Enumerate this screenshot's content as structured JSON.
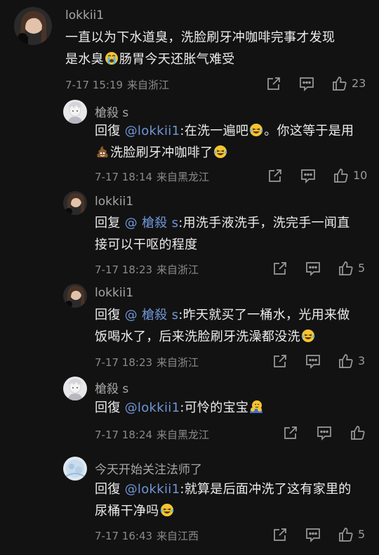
{
  "comments": [
    {
      "user": "lokkii1",
      "text_a": "一直以为下水道臭，洗脸刷牙冲咖啡完事才发现",
      "text_b1": "是水臭",
      "text_b2": "肠胃今天还胀气难受",
      "emoji_1": "crying-face",
      "time": "7-17 15:19",
      "location": "来自浙江",
      "likes": "23"
    },
    {
      "user": "槍殺 s",
      "reply_prefix": "回復 ",
      "mention": "@lokkii1",
      "line1_rest": ":在洗一遍吧",
      "line1_tail": "。你这等于是用",
      "line2_text": "洗脸刷牙冲咖啡了",
      "emoji_1": "laughing-crying-face",
      "emoji_2": "poop",
      "emoji_3": "laughing-crying-face",
      "time": "7-17 18:14",
      "location": "来自黑龙江",
      "likes": "10"
    },
    {
      "user": "lokkii1",
      "reply_prefix": "回复 ",
      "mention": "@ 槍殺 s",
      "line1_rest": ":用洗手液洗手，洗完手一闻直",
      "line2_text": "接可以干呕的程度",
      "time": "7-17 18:23",
      "location": "来自浙江",
      "likes": "5"
    },
    {
      "user": "lokkii1",
      "reply_prefix": "回復 ",
      "mention": "@ 槍殺 s",
      "line1_rest": ":昨天就买了一桶水，光用来做",
      "line2_text": "饭喝水了，后来洗脸刷牙洗澡都没洗",
      "emoji_1": "laughing-crying-face",
      "time": "7-17 18:23",
      "location": "来自浙江",
      "likes": "3"
    },
    {
      "user": "槍殺 s",
      "reply_prefix": "回復 ",
      "mention": "@lokkii1",
      "line1_rest": ":可怜的宝宝",
      "emoji_1": "hugging-face",
      "time": "7-17 18:24",
      "location": "来自黑龙江",
      "likes": ""
    },
    {
      "user": "今天开始关注法师了",
      "reply_prefix": "回復 ",
      "mention": "@lokkii1",
      "line1_rest": ":就算是后面冲洗了这有家里的",
      "line2_text": "尿桶干净吗",
      "emoji_1": "laughing-crying-face",
      "time": "7-17 16:43",
      "location": "来自江西",
      "likes": "5"
    }
  ],
  "icons": {
    "share": "share-icon",
    "reply": "comment-icon",
    "like": "thumbs-up-icon"
  },
  "colors": {
    "background": "#121212",
    "mention": "#6f96d6",
    "text": "#ececec",
    "meta": "#8a8a8a"
  }
}
